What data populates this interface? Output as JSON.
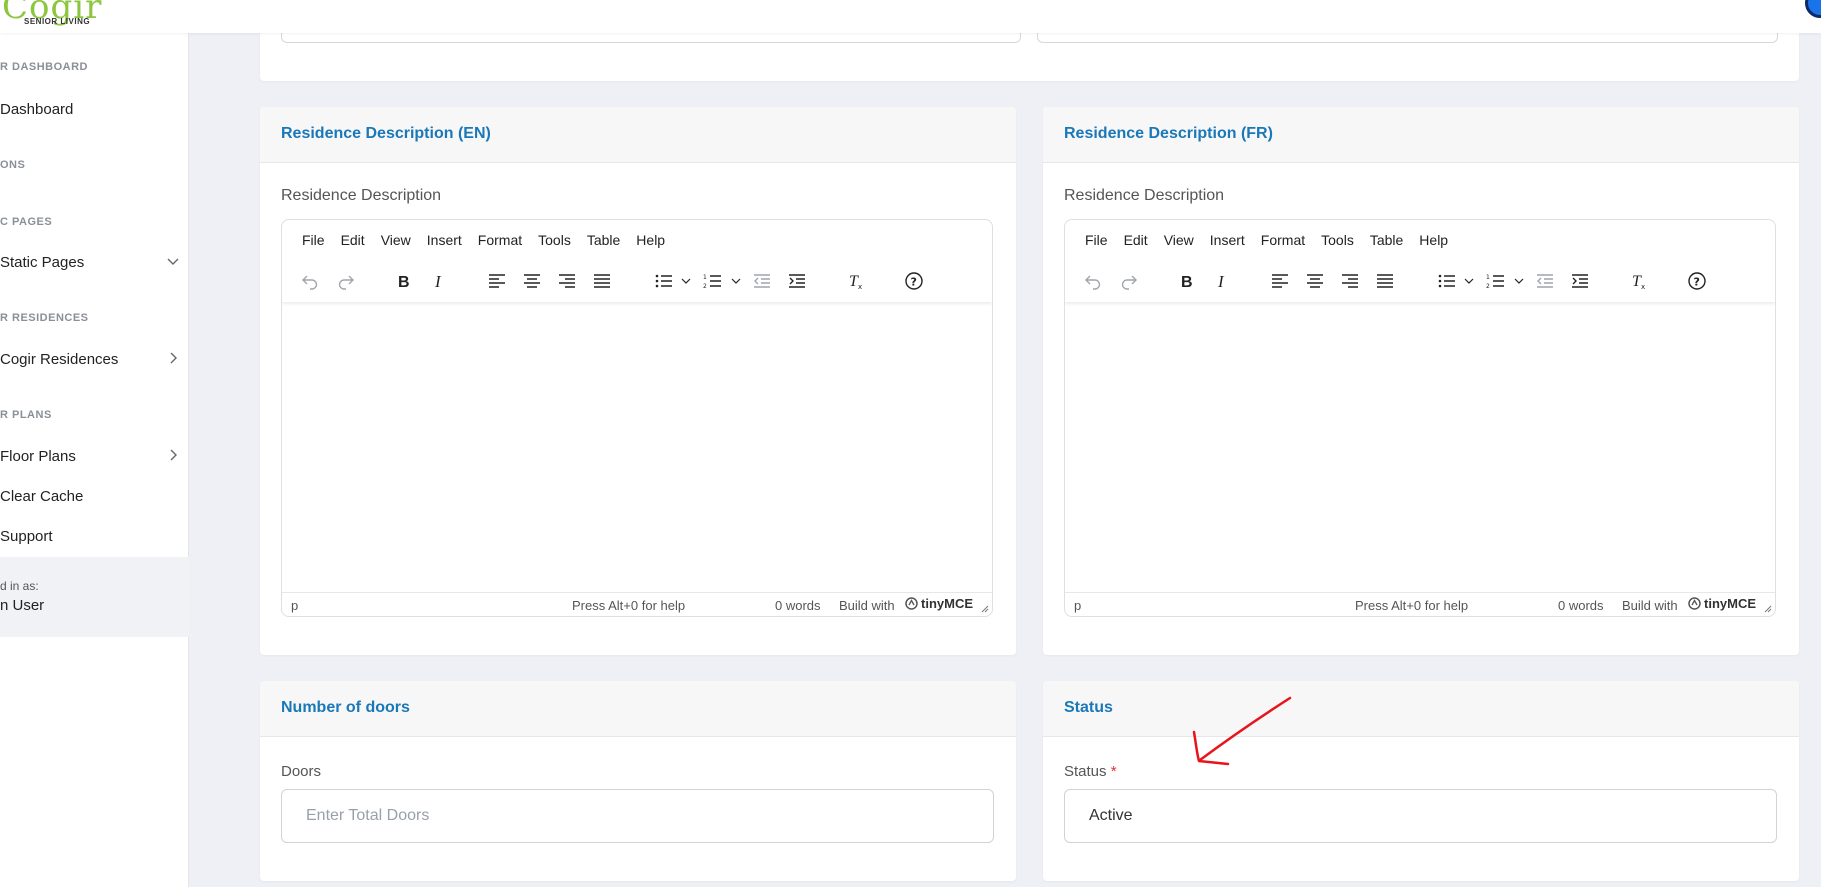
{
  "brand": {
    "logo_text": "Cogir",
    "logo_sub": "SENIOR LIVING"
  },
  "sidebar": {
    "sections": [
      {
        "heading": "R DASHBOARD",
        "items": [
          {
            "label": "Dashboard",
            "chevron": "none"
          }
        ]
      },
      {
        "heading": "ONS",
        "items": []
      },
      {
        "heading": "C PAGES",
        "items": [
          {
            "label": "Static Pages",
            "chevron": "down"
          }
        ]
      },
      {
        "heading": "R RESIDENCES",
        "items": [
          {
            "label": "Cogir Residences",
            "chevron": "right"
          }
        ]
      },
      {
        "heading": "R PLANS",
        "items": [
          {
            "label": "Floor Plans",
            "chevron": "right"
          },
          {
            "label": "Clear Cache",
            "chevron": "none"
          },
          {
            "label": "Support",
            "chevron": "none"
          }
        ]
      }
    ],
    "user": {
      "label": "d in as:",
      "name": "n User"
    }
  },
  "editor_menu": [
    "File",
    "Edit",
    "View",
    "Insert",
    "Format",
    "Tools",
    "Table",
    "Help"
  ],
  "editor_status": {
    "path": "p",
    "help": "Press Alt+0 for help",
    "words": "0 words",
    "build": "Build with",
    "brand": "tinyMCE"
  },
  "cards": {
    "desc_en": {
      "title": "Residence Description (EN)",
      "label": "Residence Description"
    },
    "desc_fr": {
      "title": "Residence Description (FR)",
      "label": "Residence Description"
    },
    "doors": {
      "title": "Number of doors",
      "label": "Doors",
      "placeholder": "Enter Total Doors",
      "value": ""
    },
    "status": {
      "title": "Status",
      "label": "Status",
      "required_mark": "*",
      "value": "Active"
    }
  },
  "colors": {
    "accent": "#1a78b8",
    "logo": "#8cc63f",
    "annotation": "#e8141c"
  }
}
